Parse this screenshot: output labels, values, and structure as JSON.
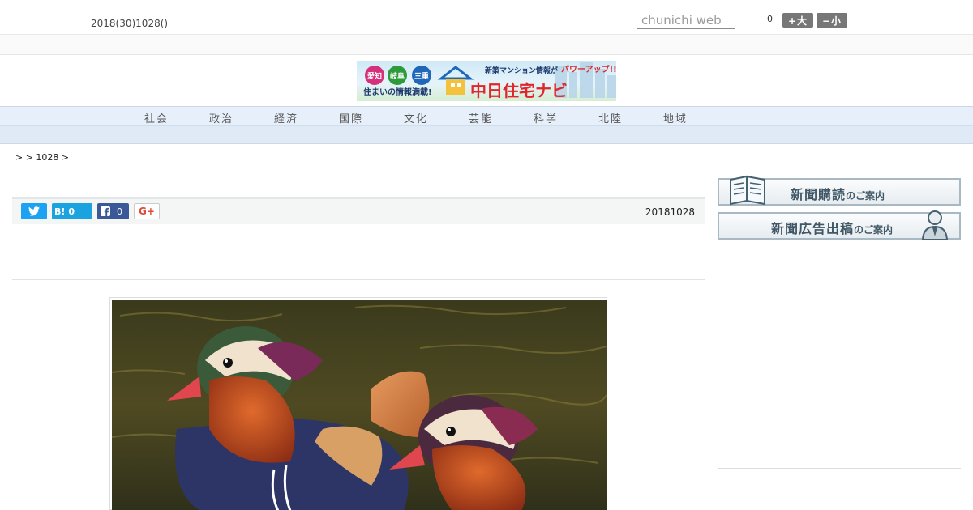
{
  "header": {
    "date": "2018(30)1028()",
    "search_placeholder": "chunichi web",
    "font_count": "0",
    "font_bigger": "+大",
    "font_smaller": "−小"
  },
  "banner": {
    "regions": [
      "愛知",
      "岐阜",
      "三重"
    ],
    "tagline": "住まいの情報満載!",
    "headline": "新築マンション情報が",
    "headline_accent": "パワーアップ!!",
    "brand": "中日住宅ナビ"
  },
  "nav": {
    "items": [
      "社会",
      "政治",
      "経済",
      "国際",
      "文化",
      "芸能",
      "科学",
      "北陸",
      "地域"
    ]
  },
  "breadcrumb": {
    "text": ">  > 1028 >"
  },
  "share": {
    "hatena_label": "B!",
    "hatena_count": "0",
    "facebook_count": "0",
    "google_label": "G+",
    "article_date": "20181028"
  },
  "sidebar": {
    "subscribe_main": "新聞購読",
    "subscribe_sub": "のご案内",
    "ad_main": "新聞広告出稿",
    "ad_sub": "のご案内"
  },
  "colors": {
    "twitter": "#1da1f2",
    "hatena": "#1ba3e0",
    "facebook": "#3b5998",
    "nav_bg": "#e7f0fa"
  }
}
